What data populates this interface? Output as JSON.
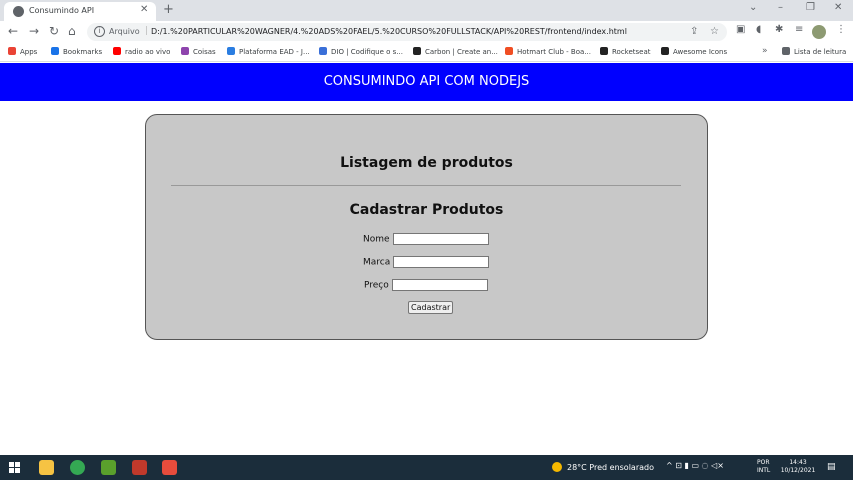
{
  "browser": {
    "tab_title": "Consumindo API",
    "tab_close": "✕",
    "new_tab": "+",
    "window_controls": [
      "⌄",
      "–",
      "❐",
      "✕"
    ],
    "nav": {
      "back": "←",
      "forward": "→",
      "reload": "↻",
      "home": "⌂"
    },
    "url_prefix": "Arquivo",
    "url_sep": "|",
    "url": "D:/1.%20PARTICULAR%20WAGNER/4.%20ADS%20FAEL/5.%20CURSO%20FULLSTACK/API%20REST/frontend/index.html",
    "omni_icons": {
      "share": "⇪",
      "star": "☆"
    },
    "toolbar_icons": [
      "▣",
      "◖",
      "✱",
      "≡",
      "⋮"
    ],
    "bookmarks": [
      {
        "label": "Apps",
        "color": "#ea4335"
      },
      {
        "label": "Bookmarks",
        "color": "#1a73e8"
      },
      {
        "label": "radio ao vivo",
        "color": "#ff0000"
      },
      {
        "label": "Coisas",
        "color": "#8e44ad"
      },
      {
        "label": "Plataforma EAD - J...",
        "color": "#2a7de1"
      },
      {
        "label": "DIO | Codifique o s...",
        "color": "#3a6fd8"
      },
      {
        "label": "Carbon | Create an...",
        "color": "#222222"
      },
      {
        "label": "Hotmart Club - Boa...",
        "color": "#f04e23"
      },
      {
        "label": "Rocketseat",
        "color": "#222222"
      },
      {
        "label": "Awesome Icons",
        "color": "#222222"
      }
    ],
    "bookmarks_more": "»",
    "reading_list": "Lista de leitura"
  },
  "app": {
    "header_title": "CONSUMINDO API COM NODEJS",
    "list_title": "Listagem de produtos",
    "form_title": "Cadastrar Produtos",
    "fields": [
      {
        "label": "Nome",
        "value": ""
      },
      {
        "label": "Marca",
        "value": ""
      },
      {
        "label": "Preço",
        "value": ""
      }
    ],
    "submit_label": "Cadastrar"
  },
  "taskbar": {
    "weather_text": "28°C  Pred ensolarado",
    "tray_icons": "^  ⊡  ▮  ▭  ◌  ◁×",
    "lang_line1": "POR",
    "lang_line2": "INTL",
    "time": "14:43",
    "date": "10/12/2021",
    "notification": "▤",
    "apps": [
      {
        "name": "file-explorer",
        "color": "#f6c343"
      },
      {
        "name": "chrome",
        "color": "#34a853"
      },
      {
        "name": "app-green",
        "color": "#5aa02c"
      },
      {
        "name": "app-red",
        "color": "#c0392b"
      },
      {
        "name": "app-orange",
        "color": "#e74c3c"
      }
    ]
  }
}
